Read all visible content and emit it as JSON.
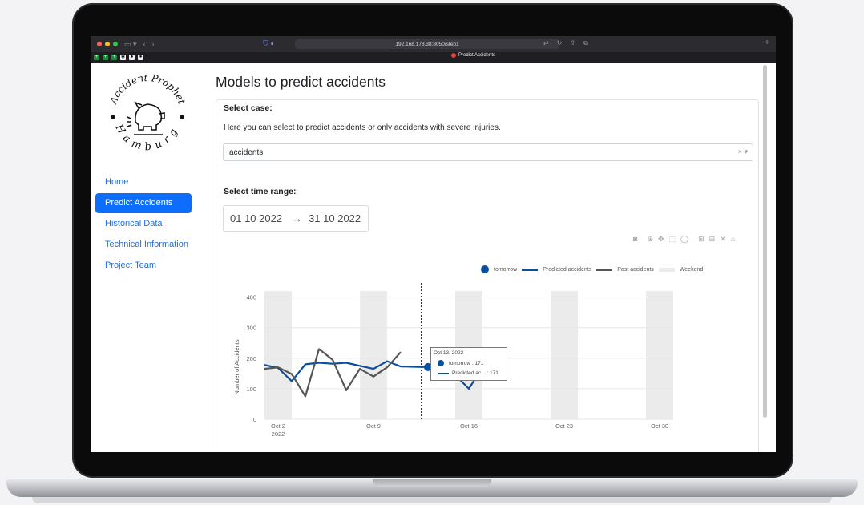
{
  "browser": {
    "url": "192.168.178.38:8050/step1",
    "tab_title": "Predict Accidents"
  },
  "logo": {
    "text_top": "Accident Prophet",
    "text_bottom": "Hamburg"
  },
  "sidebar": {
    "items": [
      {
        "label": "Home",
        "active": false
      },
      {
        "label": "Predict Accidents",
        "active": true
      },
      {
        "label": "Historical Data",
        "active": false
      },
      {
        "label": "Technical Information",
        "active": false
      },
      {
        "label": "Project Team",
        "active": false
      }
    ]
  },
  "main": {
    "title": "Models to predict accidents",
    "case_label": "Select case:",
    "case_description": "Here you can select to predict accidents or only accidents with severe injuries.",
    "case_value": "accidents",
    "range_label": "Select time range:",
    "date_start": "01 10 2022",
    "date_arrow": "→",
    "date_end": "31 10 2022"
  },
  "colors": {
    "accent": "#0d6efd",
    "predicted": "#0a4e9f",
    "past": "#555555",
    "weekend": "#ebebeb"
  },
  "chart_data": {
    "type": "line",
    "ylabel": "Number of Accidents",
    "ylim": [
      0,
      420
    ],
    "yticks": [
      0,
      100,
      200,
      300,
      400
    ],
    "xticks": [
      {
        "day": 2,
        "label": "Oct 2",
        "sublabel": "2022"
      },
      {
        "day": 9,
        "label": "Oct 9",
        "sublabel": ""
      },
      {
        "day": 16,
        "label": "Oct 16",
        "sublabel": ""
      },
      {
        "day": 23,
        "label": "Oct 23",
        "sublabel": ""
      },
      {
        "day": 30,
        "label": "Oct 30",
        "sublabel": ""
      }
    ],
    "weekend_days": [
      2,
      9,
      16,
      23,
      30
    ],
    "today_day": 12.5,
    "legend": [
      "tomorrow",
      "Predicted accidents",
      "Past accidents",
      "Weekend"
    ],
    "series": [
      {
        "name": "Predicted accidents",
        "x": [
          1,
          2,
          3,
          4,
          5,
          6,
          7,
          8,
          9,
          10,
          11,
          12,
          13,
          14,
          15,
          16,
          17
        ],
        "y": [
          178,
          168,
          125,
          180,
          185,
          182,
          185,
          175,
          165,
          190,
          173,
          172,
          171,
          168,
          145,
          100,
          170
        ]
      },
      {
        "name": "Past accidents",
        "x": [
          1,
          2,
          3,
          4,
          5,
          6,
          7,
          8,
          9,
          10,
          11
        ],
        "y": [
          165,
          170,
          148,
          75,
          230,
          195,
          95,
          165,
          140,
          170,
          220
        ]
      },
      {
        "name": "tomorrow",
        "x": [
          13
        ],
        "y": [
          171
        ]
      }
    ],
    "hover": {
      "title": "Oct 13, 2022",
      "row1": "tomorrow : 171",
      "row2": "Predicted ac... : 171"
    }
  }
}
